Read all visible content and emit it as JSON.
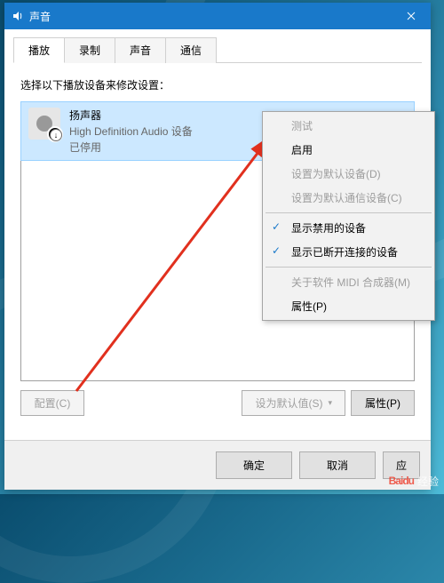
{
  "window": {
    "title": "声音",
    "tabs": [
      "播放",
      "录制",
      "声音",
      "通信"
    ],
    "active_tab": 0,
    "instruction": "选择以下播放设备来修改设置：",
    "device": {
      "name": "扬声器",
      "desc": "High Definition Audio 设备",
      "status": "已停用"
    },
    "buttons": {
      "configure": "配置(C)",
      "set_default": "设为默认值(S)",
      "properties": "属性(P)",
      "ok": "确定",
      "cancel": "取消",
      "apply": "应"
    }
  },
  "context_menu": {
    "items": [
      {
        "label": "测试",
        "disabled": true
      },
      {
        "label": "启用",
        "disabled": false
      },
      {
        "label": "设置为默认设备(D)",
        "disabled": true
      },
      {
        "label": "设置为默认通信设备(C)",
        "disabled": true
      },
      {
        "sep": true
      },
      {
        "label": "显示禁用的设备",
        "checked": true
      },
      {
        "label": "显示已断开连接的设备",
        "checked": true
      },
      {
        "sep": true
      },
      {
        "label": "关于软件 MIDI 合成器(M)",
        "disabled": true
      },
      {
        "label": "属性(P)",
        "disabled": false
      }
    ]
  },
  "watermark": {
    "brand_a": "Bai",
    "brand_b": "du",
    "text": "经验"
  }
}
